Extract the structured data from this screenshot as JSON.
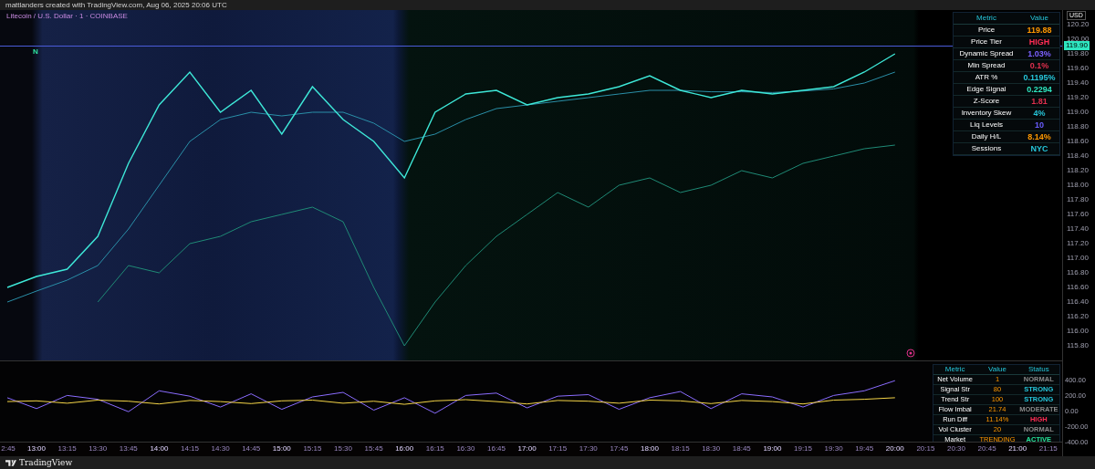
{
  "header": {
    "title": "mattlanders created with TradingView.com, Aug 06, 2025 20:06 UTC"
  },
  "legend": {
    "symbol": "Litecoin / U.S. Dollar · 1 · COINBASE",
    "marker": "N"
  },
  "price_axis": {
    "currency": "USD",
    "last_price": "119.90",
    "labels": [
      "120.20",
      "120.00",
      "119.80",
      "119.60",
      "119.40",
      "119.20",
      "119.00",
      "118.80",
      "118.60",
      "118.40",
      "118.20",
      "118.00",
      "117.80",
      "117.60",
      "117.40",
      "117.20",
      "117.00",
      "116.80",
      "116.60",
      "116.40",
      "116.20",
      "116.00",
      "115.80"
    ]
  },
  "oscillator_axis": {
    "labels": [
      "400.00",
      "200.00",
      "0.00",
      "-200.00",
      "-400.00"
    ]
  },
  "time_axis": {
    "labels": [
      "2:45",
      "13:00",
      "13:15",
      "13:30",
      "13:45",
      "14:00",
      "14:15",
      "14:30",
      "14:45",
      "15:00",
      "15:15",
      "15:30",
      "15:45",
      "16:00",
      "16:15",
      "16:30",
      "16:45",
      "17:00",
      "17:15",
      "17:30",
      "17:45",
      "18:00",
      "18:15",
      "18:30",
      "18:45",
      "19:00",
      "19:15",
      "19:30",
      "19:45",
      "20:00",
      "20:15",
      "20:30",
      "20:45",
      "21:00",
      "21:15"
    ]
  },
  "metrics_table": {
    "columns": [
      "Metric",
      "Value"
    ],
    "rows": [
      {
        "metric": "Price",
        "value": "119.88",
        "color": "#ff9800"
      },
      {
        "metric": "Price Tier",
        "value": "HIGH",
        "color": "#ff2d55"
      },
      {
        "metric": "Dynamic Spread",
        "value": "1.03%",
        "color": "#7b61ff"
      },
      {
        "metric": "Min Spread",
        "value": "0.1%",
        "color": "#e0304e"
      },
      {
        "metric": "ATR %",
        "value": "0.1195%",
        "color": "#26c6da"
      },
      {
        "metric": "Edge Signal",
        "value": "0.2294",
        "color": "#2ee6c0"
      },
      {
        "metric": "Z-Score",
        "value": "1.81",
        "color": "#e0304e"
      },
      {
        "metric": "Inventory Skew",
        "value": "4%",
        "color": "#26c6da"
      },
      {
        "metric": "Liq Levels",
        "value": "10",
        "color": "#6a5cff"
      },
      {
        "metric": "Daily H/L",
        "value": "8.14%",
        "color": "#ff9800"
      },
      {
        "metric": "Sessions",
        "value": "NYC",
        "color": "#26c6da"
      }
    ]
  },
  "status_table": {
    "columns": [
      "Metric",
      "Value",
      "Status"
    ],
    "rows": [
      {
        "metric": "Net Volume",
        "value": "1",
        "status": "NORMAL",
        "color": "#8a8a8a"
      },
      {
        "metric": "Signal Str",
        "value": "80",
        "status": "STRONG",
        "color": "#26c6da"
      },
      {
        "metric": "Trend Str",
        "value": "100",
        "status": "STRONG",
        "color": "#26c6da"
      },
      {
        "metric": "Flow Imbal",
        "value": "21.74",
        "status": "MODERATE",
        "color": "#8a8a8a"
      },
      {
        "metric": "Run Diff",
        "value": "11.14%",
        "status": "HIGH",
        "color": "#ff2d55"
      },
      {
        "metric": "Vol Cluster",
        "value": "20",
        "status": "NORMAL",
        "color": "#8a8a8a"
      },
      {
        "metric": "Market",
        "value": "TRENDING",
        "status": "ACTIVE",
        "color": "#26e69a"
      }
    ]
  },
  "footer": {
    "brand": "TradingView"
  }
}
